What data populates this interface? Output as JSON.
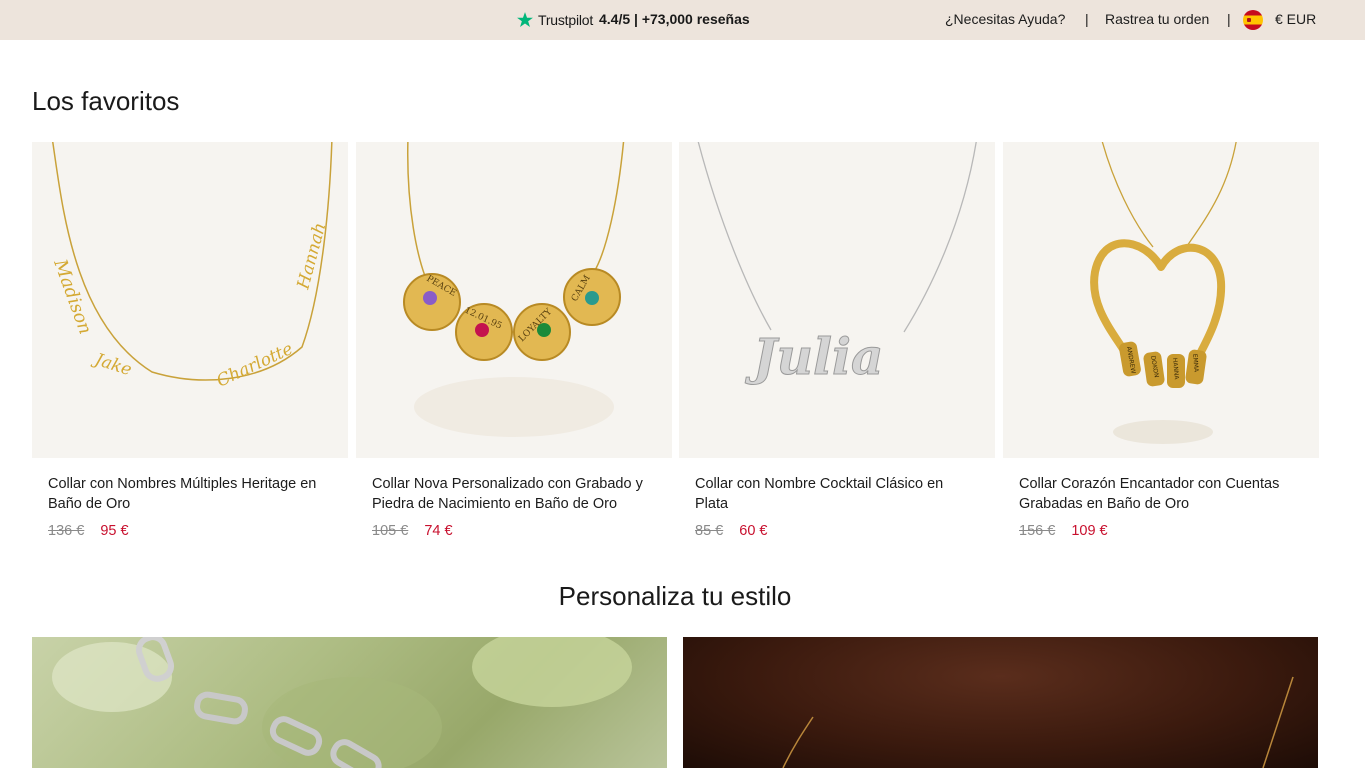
{
  "topbar": {
    "trustpilot_name": "Trustpilot",
    "rating_text": "4.4/5 | +73,000 reseñas",
    "help_label": "¿Necesitas Ayuda?",
    "separator": "|",
    "track_label": "Rastrea tu orden",
    "currency_label": "€ EUR",
    "trustpilot_color": "#00b67a"
  },
  "favorites": {
    "title": "Los favoritos",
    "products": [
      {
        "name": "Collar con Nombres Múltiples Heritage en Baño de Oro",
        "old_price": "136 €",
        "price": "95 €",
        "engraving": [
          "Madison",
          "Jake",
          "Charlotte",
          "Hannah"
        ]
      },
      {
        "name": "Collar Nova Personalizado con Grabado y Piedra de Nacimiento en Baño de Oro",
        "old_price": "105 €",
        "price": "74 €",
        "engraving": [
          "PEACE",
          "12.01.95",
          "LOYALTY",
          "CALM"
        ]
      },
      {
        "name": "Collar con Nombre Cocktail Clásico en Plata",
        "old_price": "85 €",
        "price": "60 €",
        "engraving": [
          "Julia"
        ]
      },
      {
        "name": "Collar Corazón Encantador con Cuentas Grabadas en Baño de Oro",
        "old_price": "156 €",
        "price": "109 €",
        "engraving": [
          "ANDREW",
          "DOKON",
          "HANNA",
          "EMMA"
        ]
      }
    ]
  },
  "personalize": {
    "title": "Personaliza tu estilo"
  },
  "colors": {
    "topbar_bg": "#ede4dc",
    "sale_price": "#c8102e",
    "old_price": "#8a8a8a"
  }
}
